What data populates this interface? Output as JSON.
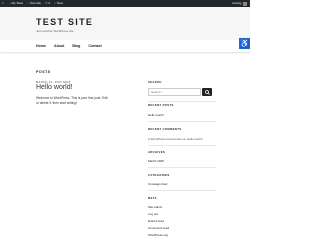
{
  "adminbar": {
    "items": [
      "My Sites",
      "Test site",
      "0",
      "New"
    ],
    "right": "Howdy,"
  },
  "header": {
    "title": "TEST SITE",
    "tagline": "Just another WordPress site",
    "accessibility_icon": "accessibility-icon"
  },
  "nav": {
    "items": [
      "Home",
      "About",
      "Blog",
      "Contact"
    ]
  },
  "main": {
    "heading": "POSTS",
    "post": {
      "date": "MARCH 12, 2025  EDIT",
      "title": "Hello world!",
      "body": "Welcome to WordPress. This is your first post. Edit or delete it, then start writing!"
    }
  },
  "sidebar": {
    "search": {
      "title": "SEARCH",
      "placeholder": "Search ..."
    },
    "recent_posts": {
      "title": "RECENT POSTS",
      "items": [
        "Hello world!"
      ]
    },
    "recent_comments": {
      "title": "RECENT COMMENTS",
      "items": [
        "A WordPress Commenter on Hello world!"
      ]
    },
    "archives": {
      "title": "ARCHIVES",
      "items": [
        "March 2025"
      ]
    },
    "categories": {
      "title": "CATEGORIES",
      "items": [
        "Uncategorized"
      ]
    },
    "meta": {
      "title": "META",
      "items": [
        "Site Admin",
        "Log out",
        "Entries feed",
        "Comments feed",
        "WordPress.org"
      ]
    }
  },
  "colors": {
    "adminbar": "#23282d",
    "header_bg": "#f6f6f6",
    "accessibility": "#1f6dc6"
  }
}
